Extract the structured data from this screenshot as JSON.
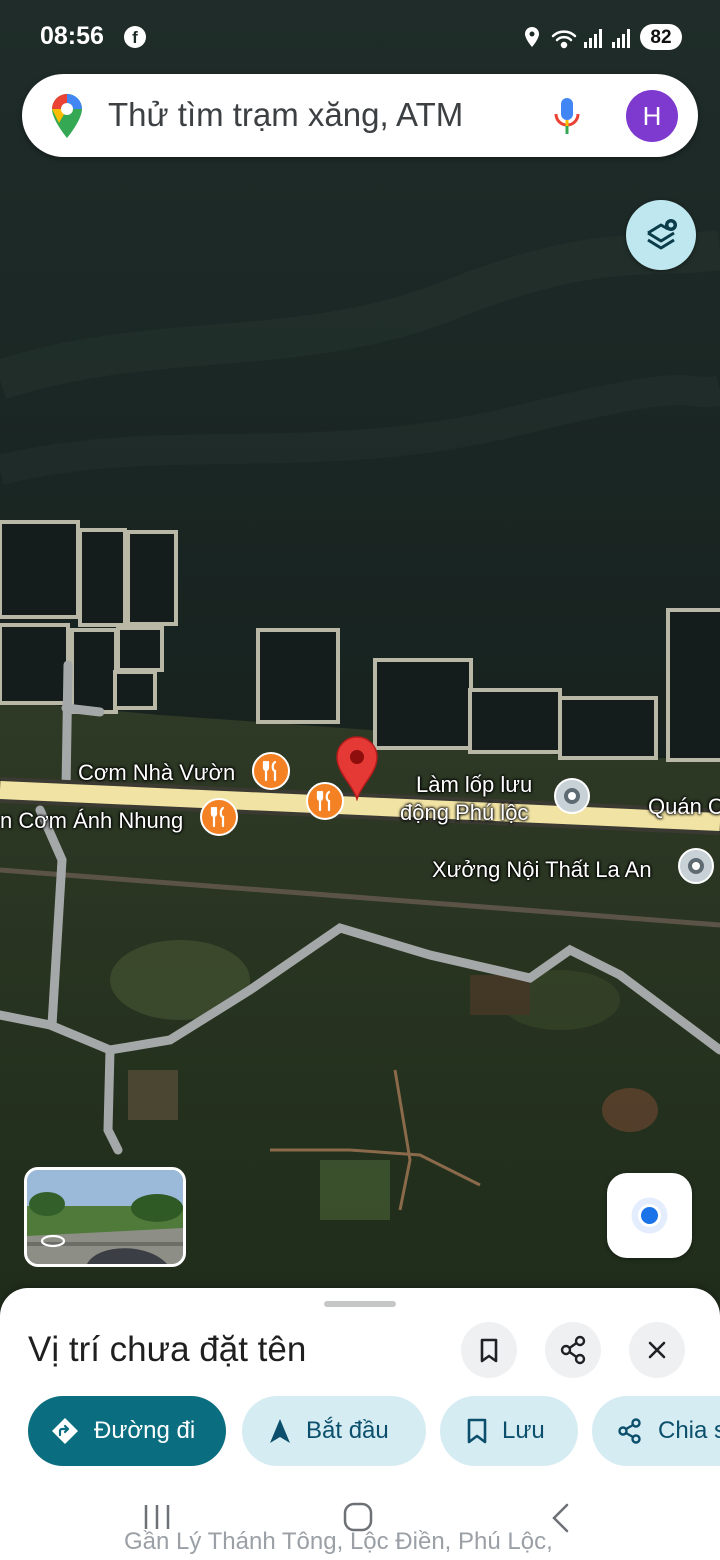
{
  "status_bar": {
    "time": "08:56",
    "battery": "82",
    "app_icon": "facebook-icon"
  },
  "search": {
    "placeholder": "Thử tìm trạm xăng, ATM",
    "avatar_letter": "H",
    "mic_icon": "mic-icon",
    "logo_icon": "google-maps-pin-icon"
  },
  "map": {
    "labels": {
      "com_nha_vuon": "Cơm Nhà Vườn",
      "com_anh_nhung": "n Cơm Ánh Nhung",
      "lam_lop_line1": "Làm lốp lưu",
      "lam_lop_line2": "động Phú lộc",
      "quan": "Quán C",
      "xuong": "Xưởng Nội Thất La An"
    },
    "colors": {
      "food_poi": "#f48225",
      "pin": "#e53935",
      "road": "#f3e7a6"
    }
  },
  "sheet": {
    "title": "Vị trí chưa đặt tên",
    "chips": {
      "directions": "Đường đi",
      "start": "Bắt đầu",
      "save": "Lưu",
      "share": "Chia s"
    },
    "address": "Gần Lý Thánh Tông, Lộc Điền, Phú Lộc,",
    "accent": "#0b6e80"
  }
}
